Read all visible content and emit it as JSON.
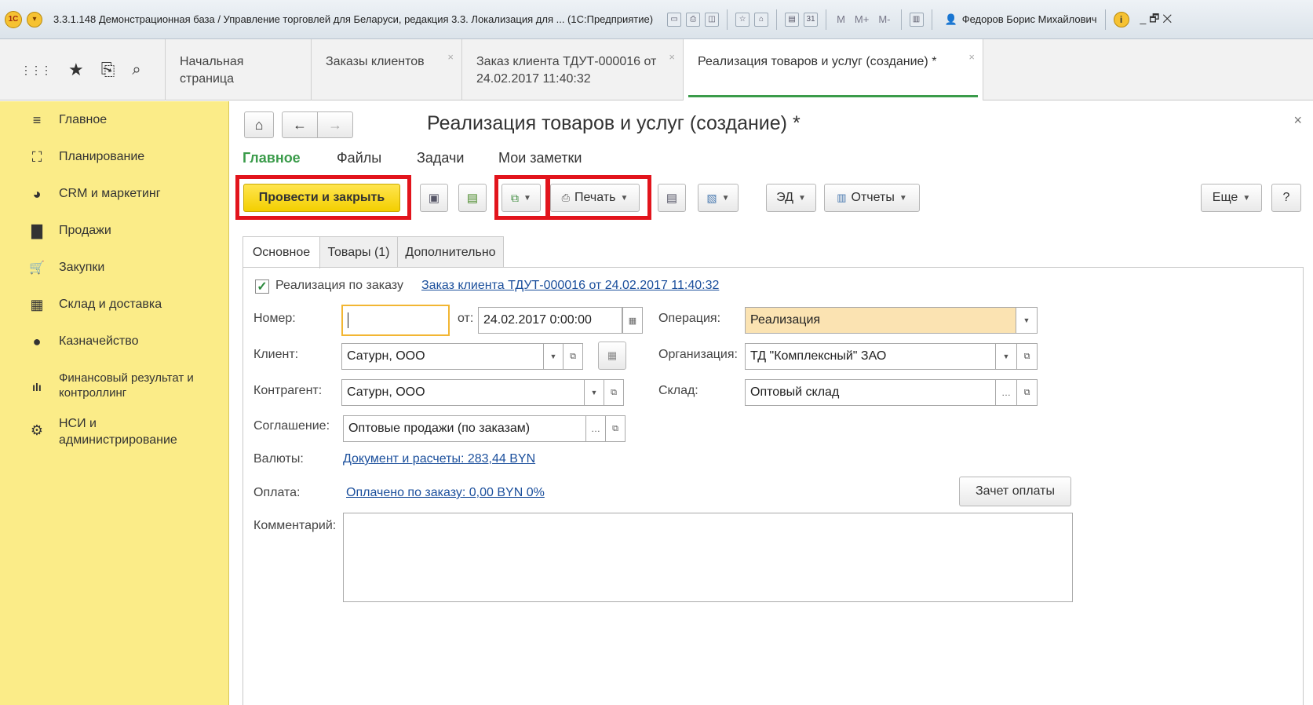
{
  "window": {
    "title": "3.3.1.148 Демонстрационная база / Управление торговлей для Беларуси, редакция 3.3. Локализация для ... (1С:Предприятие)",
    "m_buttons": [
      "M",
      "M+",
      "M-"
    ],
    "user": "Федоров Борис Михайлович",
    "info": "i",
    "win_controls": "_ 🗗 ✕"
  },
  "nav": {
    "icons": {
      "apps": "⋮⋮⋮",
      "star": "★",
      "history": "⎘",
      "search": "🔍"
    },
    "tabs": [
      {
        "label": "Начальная страница"
      },
      {
        "label": "Заказы клиентов"
      },
      {
        "label": "Заказ клиента ТДУТ-000016 от 24.02.2017 11:40:32"
      },
      {
        "label": "Реализация товаров и услуг (создание) *"
      }
    ],
    "close": "×"
  },
  "sidebar": {
    "items": [
      {
        "label": "Главное",
        "icon": "≡"
      },
      {
        "label": "Планирование",
        "icon": "⛶"
      },
      {
        "label": "CRM и маркетинг",
        "icon": "◕"
      },
      {
        "label": "Продажи",
        "icon": "▇"
      },
      {
        "label": "Закупки",
        "icon": "🛒"
      },
      {
        "label": "Склад и доставка",
        "icon": "▦"
      },
      {
        "label": "Казначейство",
        "icon": "●"
      },
      {
        "label": "Финансовый результат и\nконтроллинг",
        "label_line1": "Финансовый результат и",
        "label_line2": "контроллинг",
        "icon": "ılı"
      },
      {
        "label": "НСИ и\nадминистрирование",
        "label_line1": "НСИ и",
        "label_line2": "администрирование",
        "icon": "⚙"
      }
    ]
  },
  "form": {
    "title": "Реализация товаров и услуг (создание) *",
    "home": "⌂",
    "back": "←",
    "forward": "→",
    "close": "×",
    "sections": [
      "Главное",
      "Файлы",
      "Задачи",
      "Мои заметки"
    ],
    "toolbar": {
      "post_close": "Провести и закрыть",
      "print": "Печать",
      "ed": "ЭД",
      "reports": "Отчеты",
      "more": "Еще",
      "help": "?"
    },
    "tabs": [
      "Основное",
      "Товары (1)",
      "Дополнительно"
    ],
    "by_order_label": "Реализация по заказу",
    "by_order_link": "Заказ клиента ТДУТ-000016 от 24.02.2017 11:40:32",
    "number_label": "Номер:",
    "number_value": "",
    "date_label": "от:",
    "date_value": "24.02.2017  0:00:00",
    "operation_label": "Операция:",
    "operation_value": "Реализация",
    "client_label": "Клиент:",
    "client_value": "Сатурн, ООО",
    "organization_label": "Организация:",
    "organization_value": "ТД \"Комплексный\" ЗАО",
    "counterparty_label": "Контрагент:",
    "counterparty_value": "Сатурн, ООО",
    "warehouse_label": "Склад:",
    "warehouse_value": "Оптовый склад",
    "agreement_label": "Соглашение:",
    "agreement_value": "Оптовые продажи (по заказам)",
    "currencies_label": "Валюты:",
    "currencies_link": "Документ и расчеты: 283,44 BYN",
    "payment_label": "Оплата:",
    "payment_link": "Оплачено по заказу: 0,00 BYN  0%",
    "offset_button": "Зачет оплаты",
    "comment_label": "Комментарий:",
    "comment_value": ""
  }
}
